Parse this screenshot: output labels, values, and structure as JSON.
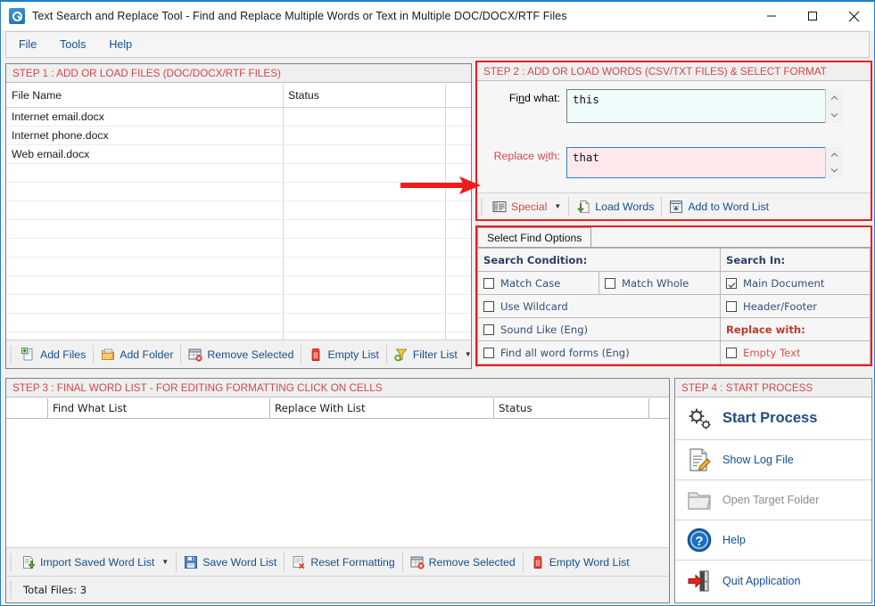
{
  "window": {
    "title": "Text Search and Replace Tool  - Find and Replace Multiple Words or Text  in Multiple DOC/DOCX/RTF Files",
    "app_icon": "wrench-icon",
    "minimize_label": "—",
    "maximize_label": "□",
    "close_label": "✕"
  },
  "menubar": {
    "items": [
      {
        "label": "File"
      },
      {
        "label": "Tools"
      },
      {
        "label": "Help"
      }
    ]
  },
  "step1": {
    "header": "STEP 1 : ADD OR LOAD FILES (DOC/DOCX/RTF FILES)",
    "columns": [
      "File Name",
      "Status"
    ],
    "rows": [
      {
        "file_name": "Internet email.docx",
        "status": ""
      },
      {
        "file_name": "Internet phone.docx",
        "status": ""
      },
      {
        "file_name": "Web email.docx",
        "status": ""
      }
    ],
    "toolbar": [
      {
        "label": "Add Files",
        "icon": "add-file-icon",
        "has_caret": false
      },
      {
        "label": "Add Folder",
        "icon": "add-folder-icon",
        "has_caret": false
      },
      {
        "label": "Remove Selected",
        "icon": "remove-row-icon",
        "has_caret": false
      },
      {
        "label": "Empty List",
        "icon": "trash-icon",
        "has_caret": false
      },
      {
        "label": "Filter List",
        "icon": "filter-icon",
        "has_caret": true
      }
    ]
  },
  "step2": {
    "header": "STEP 2 : ADD OR LOAD WORDS (CSV/TXT FILES) & SELECT FORMAT",
    "find_label": "Find what:",
    "find_label_pre": "Fi",
    "find_label_accel": "n",
    "find_label_post": "d what:",
    "find_value": "this",
    "replace_label_pre": "Replace w",
    "replace_label_accel": "i",
    "replace_label_post": "th:",
    "replace_value": "that",
    "toolbar": [
      {
        "label": "Special",
        "icon": "special-list-icon",
        "has_caret": true
      },
      {
        "label": "Load Words",
        "icon": "load-words-icon",
        "has_caret": false
      },
      {
        "label": "Add to Word List",
        "icon": "add-to-list-icon",
        "has_caret": false
      }
    ]
  },
  "find_options": {
    "tab_label": "Select Find Options",
    "search_condition_header": "Search Condition:",
    "search_in_header": "Search In:",
    "replace_with_header": "Replace with:",
    "conditions": [
      {
        "label": "Match Case",
        "checked": false
      },
      {
        "label": "Match Whole",
        "checked": false
      },
      {
        "label": "Use Wildcard",
        "checked": false
      },
      {
        "label": "Sound Like (Eng)",
        "checked": false
      },
      {
        "label": "Find all word forms (Eng)",
        "checked": false
      }
    ],
    "search_in": [
      {
        "label": "Main Document",
        "checked": true
      },
      {
        "label": "Header/Footer",
        "checked": false
      }
    ],
    "replace_with_options": [
      {
        "label": "Empty Text",
        "checked": false
      }
    ]
  },
  "annotation": {
    "arrow_color": "#ee1c1c",
    "arrow_direction": "right"
  },
  "step3": {
    "header": "STEP 3 : FINAL WORD LIST - FOR EDITING FORMATTING CLICK ON CELLS",
    "columns": [
      "",
      "Find What List",
      "Replace With List",
      "Status"
    ],
    "rows": [],
    "toolbar": [
      {
        "label": "Import Saved Word List",
        "icon": "import-icon",
        "has_caret": true
      },
      {
        "label": "Save Word List",
        "icon": "save-icon",
        "has_caret": false
      },
      {
        "label": "Reset Formatting",
        "icon": "reset-format-icon",
        "has_caret": false
      },
      {
        "label": "Remove Selected",
        "icon": "remove-row-icon",
        "has_caret": false
      },
      {
        "label": "Empty Word List",
        "icon": "trash-icon",
        "has_caret": false
      }
    ],
    "status_text": "Total Files: 3"
  },
  "step4": {
    "header": "STEP 4 : START PROCESS",
    "items": [
      {
        "label": "Start Process",
        "icon": "gears-icon",
        "disabled": false
      },
      {
        "label": "Show Log File",
        "icon": "log-file-icon",
        "disabled": false
      },
      {
        "label": "Open Target Folder",
        "icon": "folder-icon",
        "disabled": true
      },
      {
        "label": "Help",
        "icon": "help-icon",
        "disabled": false
      },
      {
        "label": "Quit Application",
        "icon": "exit-icon",
        "disabled": false
      }
    ]
  },
  "colors": {
    "step_header_red": "#d1484a",
    "accent_blue": "#14508c",
    "highlight_border_red": "#ee1c1c",
    "find_field_bg": "#effafa",
    "replace_field_bg": "#fde9ec"
  }
}
